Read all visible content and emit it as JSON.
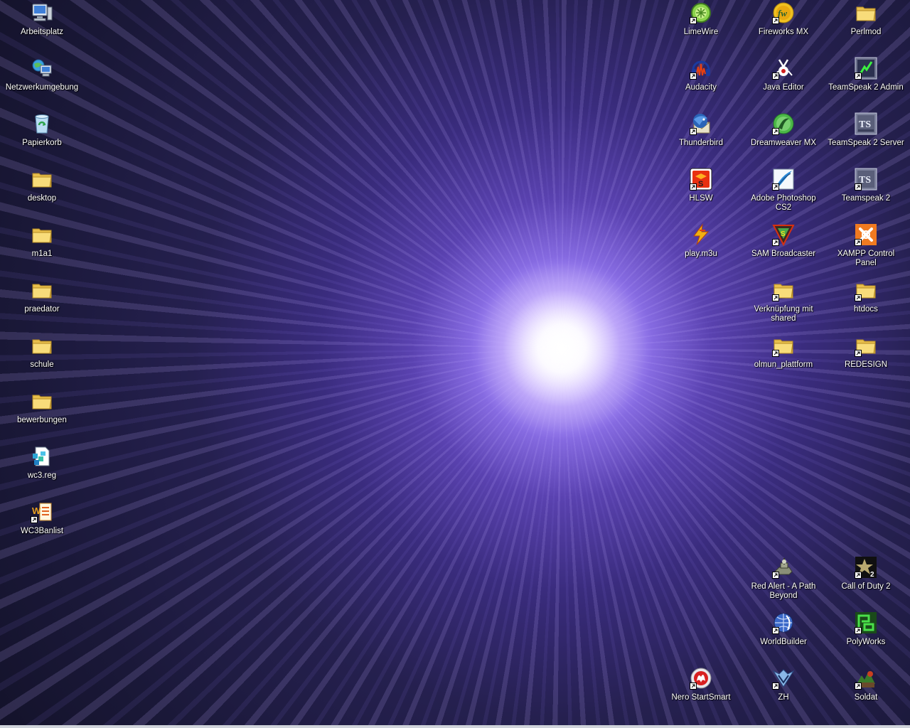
{
  "desktop": {
    "left_icons": [
      {
        "label": "Arbeitsplatz",
        "icon": "computer-icon"
      },
      {
        "label": "Netzwerkumgebung",
        "icon": "network-icon"
      },
      {
        "label": "Papierkorb",
        "icon": "recycle-bin-icon"
      },
      {
        "label": "desktop",
        "icon": "folder-icon"
      },
      {
        "label": "m1a1",
        "icon": "folder-icon"
      },
      {
        "label": "praedator",
        "icon": "folder-icon"
      },
      {
        "label": "schule",
        "icon": "folder-icon"
      },
      {
        "label": "bewerbungen",
        "icon": "folder-icon"
      },
      {
        "label": "wc3.reg",
        "icon": "registry-file-icon"
      },
      {
        "label": "WC3Banlist",
        "icon": "wc3banlist-icon"
      }
    ],
    "right_icons": [
      {
        "label": "LimeWire",
        "icon": "limewire-icon"
      },
      {
        "label": "Fireworks MX",
        "icon": "fireworks-icon"
      },
      {
        "label": "Perlmod",
        "icon": "folder-icon"
      },
      {
        "label": "Audacity",
        "icon": "audacity-icon"
      },
      {
        "label": "Java Editor",
        "icon": "java-editor-icon"
      },
      {
        "label": "TeamSpeak 2 Admin",
        "icon": "teamspeak-admin-icon"
      },
      {
        "label": "Thunderbird",
        "icon": "thunderbird-icon"
      },
      {
        "label": "Dreamweaver MX",
        "icon": "dreamweaver-icon"
      },
      {
        "label": "TeamSpeak 2 Server",
        "icon": "teamspeak-server-icon"
      },
      {
        "label": "HLSW",
        "icon": "hlsw-icon"
      },
      {
        "label": "Adobe Photoshop CS2",
        "icon": "photoshop-icon"
      },
      {
        "label": "Teamspeak 2",
        "icon": "teamspeak-icon"
      },
      {
        "label": "play.m3u",
        "icon": "winamp-playlist-icon"
      },
      {
        "label": "SAM Broadcaster",
        "icon": "sam-broadcaster-icon"
      },
      {
        "label": "XAMPP Control Panel",
        "icon": "xampp-icon"
      },
      {
        "label": "Verknüpfung mit shared",
        "icon": "folder-shortcut-icon"
      },
      {
        "label": "htdocs",
        "icon": "folder-shortcut-icon"
      },
      {
        "label": "olmun_plattform",
        "icon": "folder-shortcut-icon"
      },
      {
        "label": "REDESIGN",
        "icon": "folder-shortcut-icon"
      },
      {
        "label": "Red Alert - A Path Beyond",
        "icon": "red-alert-icon"
      },
      {
        "label": "Call of Duty 2",
        "icon": "call-of-duty-icon"
      },
      {
        "label": "WorldBuilder",
        "icon": "worldbuilder-icon"
      },
      {
        "label": "PolyWorks",
        "icon": "polyworks-icon"
      },
      {
        "label": "Nero StartSmart",
        "icon": "nero-icon"
      },
      {
        "label": "ZH",
        "icon": "zh-icon"
      },
      {
        "label": "Soldat",
        "icon": "soldat-icon"
      }
    ]
  },
  "colors": {
    "label_text": "#ffffff",
    "folder": "#f5d36b",
    "wallpaper_center": "#ffffff",
    "wallpaper_edge": "#121127"
  }
}
